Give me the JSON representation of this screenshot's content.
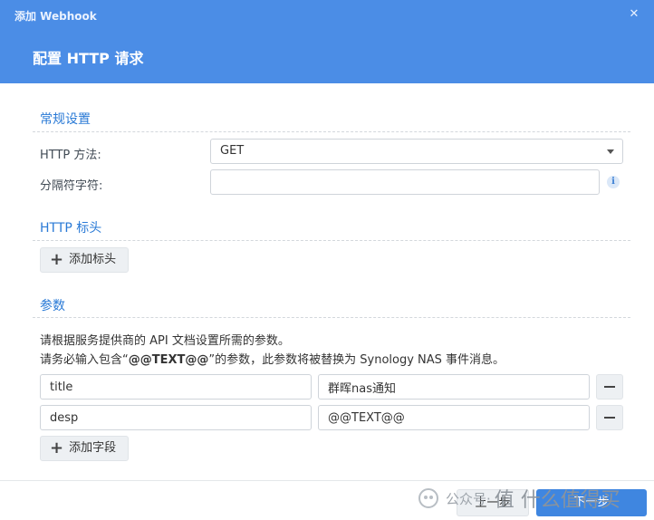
{
  "window": {
    "title": "添加 Webhook",
    "heading": "配置 HTTP 请求"
  },
  "general": {
    "title": "常规设置",
    "method_label": "HTTP 方法:",
    "method_value": "GET",
    "separator_label": "分隔符字符:",
    "separator_value": "",
    "info_glyph": "i"
  },
  "headers": {
    "title": "HTTP 标头",
    "add_label": "添加标头"
  },
  "params": {
    "title": "参数",
    "help_line1": "请根据服务提供商的 API 文档设置所需的参数。",
    "help_line2_prefix": "请务必输入包含“",
    "help_line2_token": "@@TEXT@@",
    "help_line2_suffix": "”的参数，此参数将被替换为 Synology NAS 事件消息。",
    "rows": [
      {
        "key": "title",
        "value": "群晖nas通知"
      },
      {
        "key": "desp",
        "value": "@@TEXT@@"
      }
    ],
    "add_label": "添加字段"
  },
  "footer": {
    "prev_label": "上一步",
    "next_label": "下一步"
  },
  "watermark": {
    "left_text": "公众号·",
    "right_text": "值 什么值得买"
  },
  "colors": {
    "accent": "#4b8de6",
    "section_title": "#2a7ad6",
    "primary_button": "#3f86e0"
  }
}
